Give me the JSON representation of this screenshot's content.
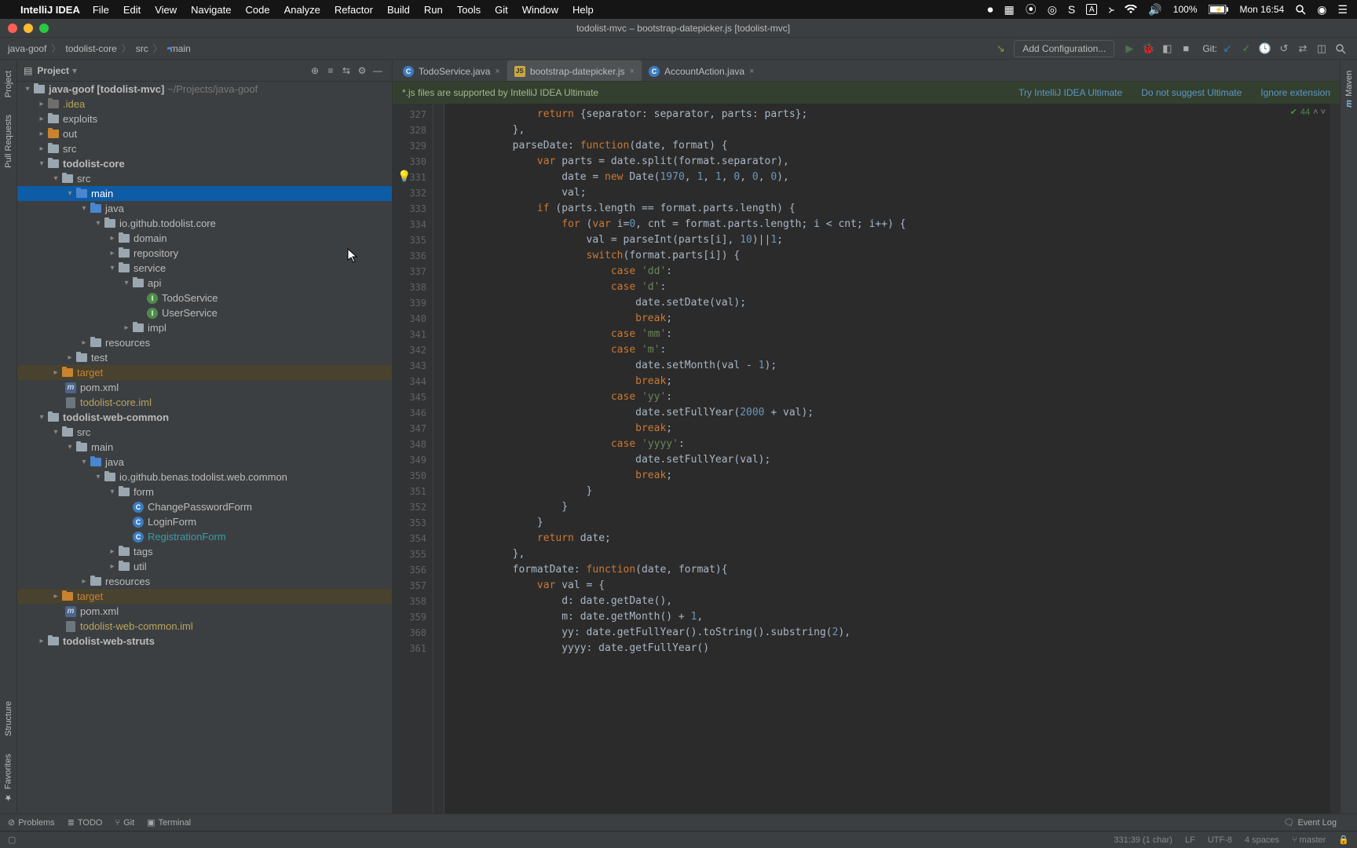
{
  "macMenu": {
    "app": "IntelliJ IDEA",
    "items": [
      "File",
      "Edit",
      "View",
      "Navigate",
      "Code",
      "Analyze",
      "Refactor",
      "Build",
      "Run",
      "Tools",
      "Git",
      "Window",
      "Help"
    ],
    "battery": "100%",
    "clock": "Mon 16:54"
  },
  "window": {
    "title": "todolist-mvc – bootstrap-datepicker.js [todolist-mvc]"
  },
  "breadcrumbs": [
    "java-goof",
    "todolist-core",
    "src",
    "main"
  ],
  "toolbar": {
    "config": "Add Configuration...",
    "git": "Git:"
  },
  "projectPanel": {
    "title": "Project"
  },
  "leftTabs": [
    "Project",
    "Pull Requests",
    "Structure",
    "Favorites"
  ],
  "rightTabs": [
    "Maven"
  ],
  "tree": {
    "root": "java-goof",
    "rootTag": "[todolist-mvc]",
    "rootPath": "~/Projects/java-goof",
    "idea": ".idea",
    "exploits": "exploits",
    "out": "out",
    "src": "src",
    "todoCore": "todolist-core",
    "src2": "src",
    "main": "main",
    "java": "java",
    "pkg1": "io.github.todolist.core",
    "domain": "domain",
    "repository": "repository",
    "service": "service",
    "api": "api",
    "todoService": "TodoService",
    "userService": "UserService",
    "impl": "impl",
    "resources": "resources",
    "test": "test",
    "target": "target",
    "pom": "pom.xml",
    "iml1": "todolist-core.iml",
    "webCommon": "todolist-web-common",
    "src3": "src",
    "main2": "main",
    "java2": "java",
    "pkg2": "io.github.benas.todolist.web.common",
    "form": "form",
    "cpf": "ChangePasswordForm",
    "lf": "LoginForm",
    "rf": "RegistrationForm",
    "tags": "tags",
    "util": "util",
    "resources2": "resources",
    "target2": "target",
    "pom2": "pom.xml",
    "iml2": "todolist-web-common.iml",
    "webStruts": "todolist-web-struts"
  },
  "editorTabs": [
    {
      "label": "TodoService.java",
      "type": "class"
    },
    {
      "label": "bootstrap-datepicker.js",
      "type": "js",
      "active": true
    },
    {
      "label": "AccountAction.java",
      "type": "class"
    }
  ],
  "banner": {
    "msg": "*.js files are supported by IntelliJ IDEA Ultimate",
    "try": "Try IntelliJ IDEA Ultimate",
    "noSuggest": "Do not suggest Ultimate",
    "ignore": "Ignore extension"
  },
  "code": {
    "startLine": 327,
    "inspectionCount": "44"
  },
  "bottomTabs": {
    "problems": "Problems",
    "todo": "TODO",
    "git": "Git",
    "terminal": "Terminal",
    "eventLog": "Event Log"
  },
  "status": {
    "pos": "331:39 (1 char)",
    "lf": "LF",
    "enc": "UTF-8",
    "indent": "4 spaces",
    "branch": "master"
  }
}
